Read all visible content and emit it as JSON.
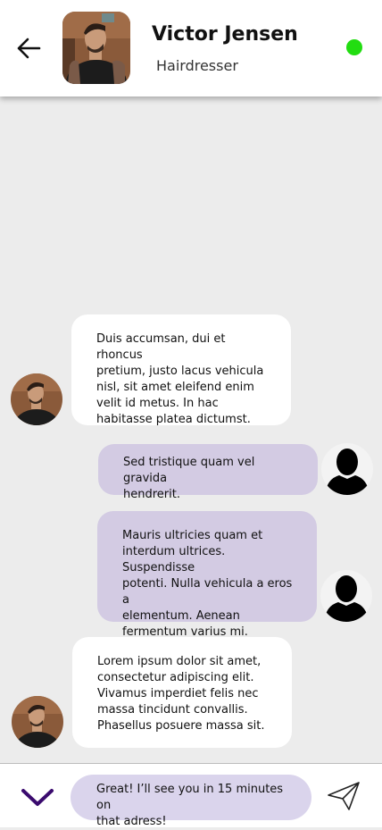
{
  "header": {
    "name": "Victor Jensen",
    "role": "Hairdresser",
    "status_color": "#22dd11",
    "back_icon": "arrow-left-icon"
  },
  "messages": [
    {
      "direction": "incoming",
      "text": "Duis accumsan, dui et rhoncus\npretium, justo lacus vehicula\nnisl, sit amet eleifend enim\nvelit id metus. In hac\nhabitasse platea dictumst."
    },
    {
      "direction": "outgoing",
      "text": "Sed tristique quam vel gravida\nhendrerit."
    },
    {
      "direction": "outgoing",
      "text": "Mauris ultricies quam et\ninterdum ultrices. Suspendisse\npotenti. Nulla vehicula a eros a\nelementum. Aenean\nfermentum varius mi."
    },
    {
      "direction": "incoming",
      "text": "Lorem ipsum dolor sit amet,\nconsectetur adipiscing elit.\nVivamus imperdiet felis nec\nmassa tincidunt convallis.\nPhasellus posuere massa sit."
    }
  ],
  "composer": {
    "draft": "Great! I’ll see you in 15 minutes on\nthat adress!",
    "expand_icon": "chevron-down-icon",
    "send_icon": "paper-plane-icon"
  },
  "colors": {
    "incoming_bubble": "#ffffff",
    "outgoing_bubble": "#d3cbe3",
    "input_bg": "#dad4ec",
    "accent": "#3a0a6e"
  }
}
